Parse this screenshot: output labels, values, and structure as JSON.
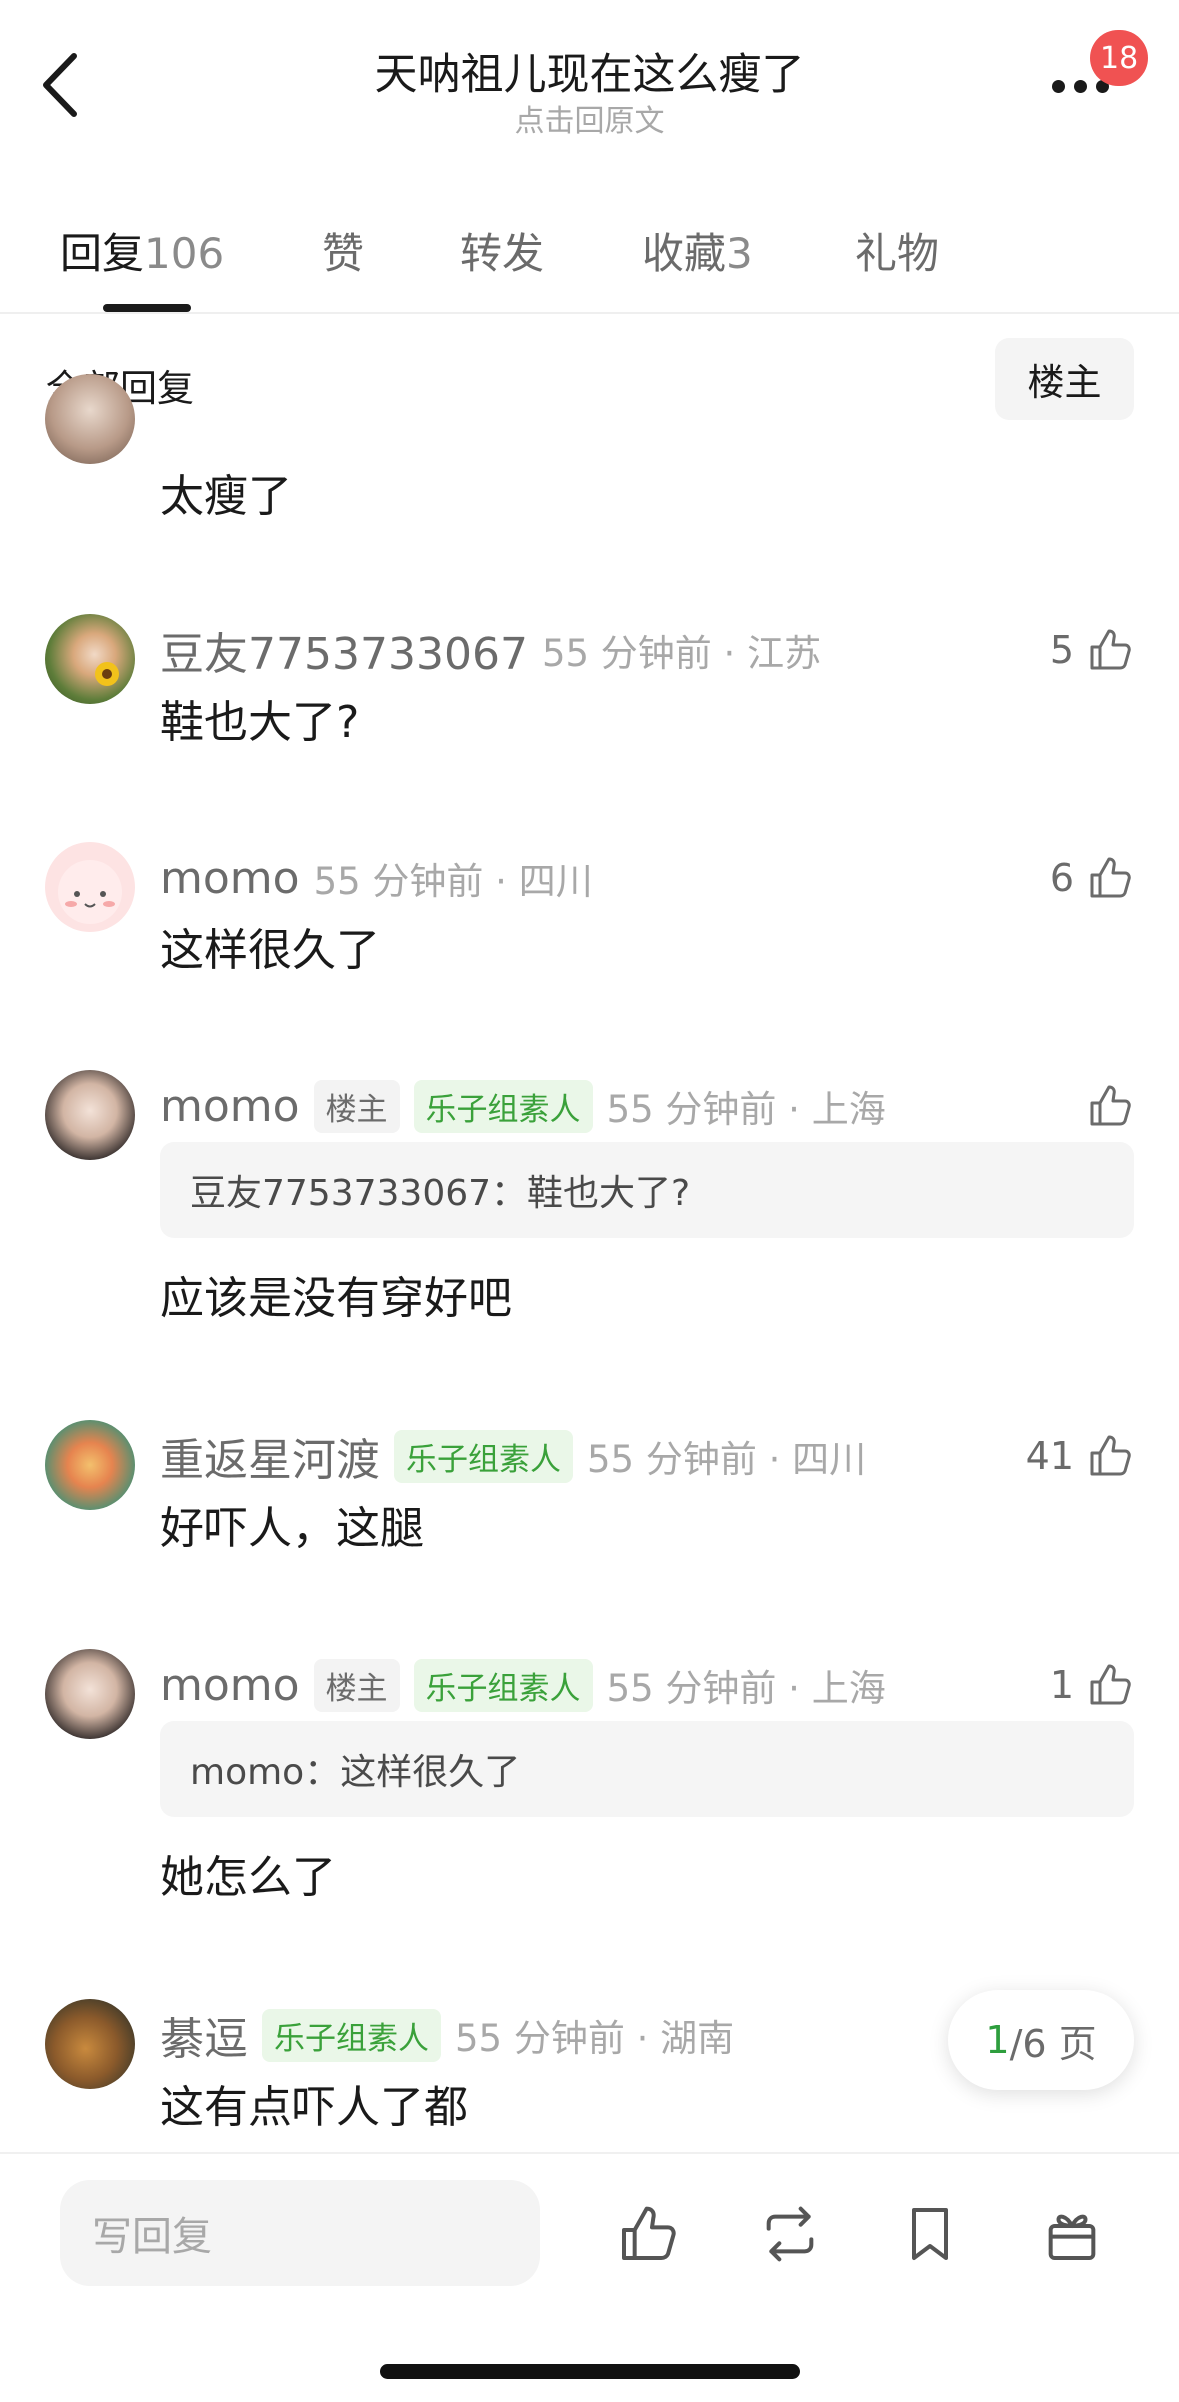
{
  "header": {
    "title": "天呐祖儿现在这么瘦了",
    "subtitle": "点击回原文",
    "notification_count": "18"
  },
  "tabs": [
    {
      "label": "回复",
      "count": "106"
    },
    {
      "label": "赞",
      "count": ""
    },
    {
      "label": "转发",
      "count": ""
    },
    {
      "label": "收藏",
      "count": "3"
    },
    {
      "label": "礼物",
      "count": ""
    }
  ],
  "filter": {
    "label": "全部回复",
    "op_button": "楼主"
  },
  "comments": [
    {
      "username": "",
      "time_loc": "",
      "text": "太瘦了",
      "likes": ""
    },
    {
      "username": "豆友7753733067",
      "time_loc": "55 分钟前 · 江苏",
      "text": "鞋也大了?",
      "likes": "5"
    },
    {
      "username": "momo",
      "time_loc": "55 分钟前 · 四川",
      "text": "这样很久了",
      "likes": "6"
    },
    {
      "username": "momo",
      "tag_op": "楼主",
      "tag_green": "乐子组素人",
      "time_loc": "55 分钟前 · 上海",
      "quote": "豆友7753733067：鞋也大了?",
      "text": "应该是没有穿好吧",
      "likes": ""
    },
    {
      "username": "重返星河渡",
      "tag_green": "乐子组素人",
      "time_loc": "55 分钟前 · 四川",
      "text": "好吓人，这腿",
      "likes": "41"
    },
    {
      "username": "momo",
      "tag_op": "楼主",
      "tag_green": "乐子组素人",
      "time_loc": "55 分钟前 · 上海",
      "quote": "momo：这样很久了",
      "text": "她怎么了",
      "likes": "1"
    },
    {
      "username": "綦逗",
      "tag_green": "乐子组素人",
      "time_loc": "55 分钟前 · 湖南",
      "text": "这有点吓人了都",
      "likes": ""
    }
  ],
  "pagination": {
    "current": "1",
    "total": "/6 页"
  },
  "bottom_bar": {
    "placeholder": "写回复"
  },
  "icons": [
    "back-arrow-icon",
    "more-icon",
    "thumbs-up-icon",
    "repost-icon",
    "bookmark-icon",
    "gift-icon"
  ]
}
